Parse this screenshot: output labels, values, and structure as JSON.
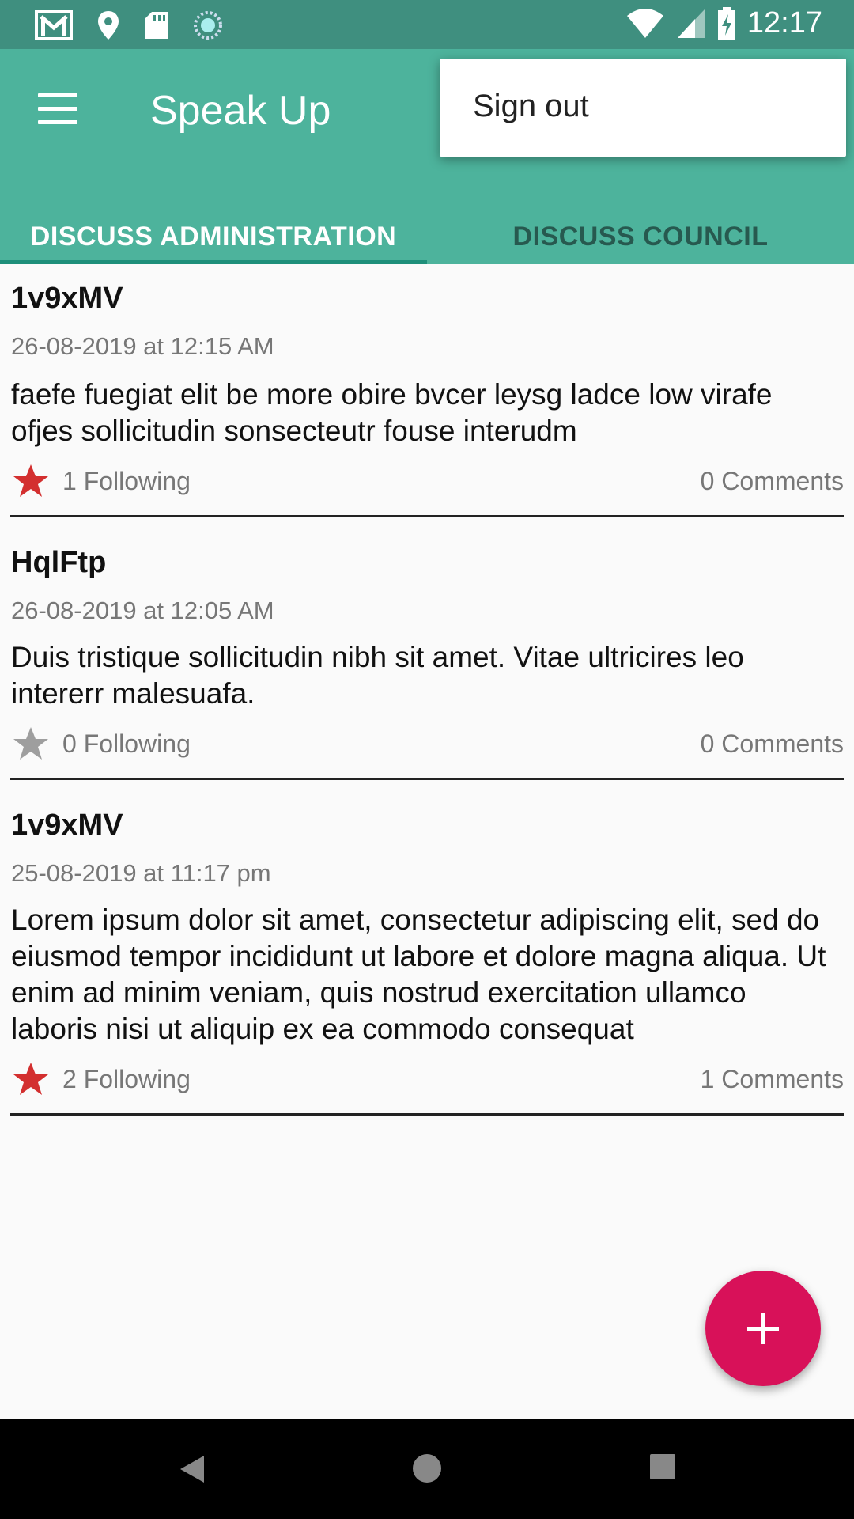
{
  "status_bar": {
    "time": "12:17",
    "icons_left": [
      "gmail-icon",
      "location-icon",
      "sd-card-icon",
      "sync-icon"
    ],
    "icons_right": [
      "wifi-icon",
      "signal-icon",
      "battery-charging-icon"
    ]
  },
  "app_bar": {
    "title": "Speak Up",
    "menu_icon": "hamburger-menu-icon"
  },
  "tabs": [
    {
      "label": "DISCUSS ADMINISTRATION",
      "active": true
    },
    {
      "label": "DISCUSS COUNCIL",
      "active": false
    }
  ],
  "overflow_menu": {
    "items": [
      {
        "label": "Sign out"
      }
    ]
  },
  "posts": [
    {
      "author": "1v9xMV",
      "date": "26-08-2019 at 12:15 AM",
      "body": "faefe fuegiat elit be more obire bvcer leysg ladce low virafe ofjes sollicitudin sonsecteutr fouse interudm",
      "following": "1 Following",
      "comments": "0 Comments",
      "starred": true
    },
    {
      "author": "HqlFtp",
      "date": "26-08-2019 at 12:05 AM",
      "body": "Duis tristique sollicitudin nibh sit amet. Vitae ultricires leo intererr malesuafa.",
      "following": "0 Following",
      "comments": "0 Comments",
      "starred": false
    },
    {
      "author": "1v9xMV",
      "date": "25-08-2019 at 11:17 pm",
      "body": "Lorem ipsum dolor sit amet, consectetur adipiscing elit, sed do eiusmod tempor incididunt ut labore et dolore magna aliqua. Ut enim ad minim veniam, quis nostrud exercitation ullamco laboris nisi ut aliquip ex ea commodo consequat",
      "following": "2 Following",
      "comments": "1 Comments",
      "starred": true
    }
  ],
  "colors": {
    "status_bar": "#3f8f7f",
    "app_bar": "#4db39c",
    "fab": "#d81159",
    "star_active": "#d32f2f",
    "star_inactive": "#9e9e9e"
  }
}
